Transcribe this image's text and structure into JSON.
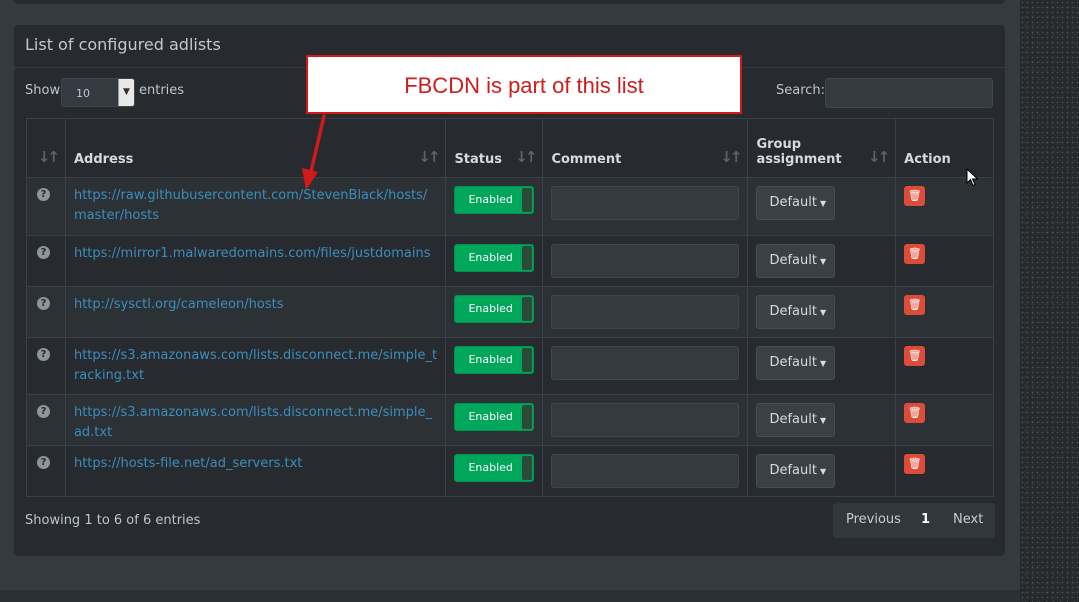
{
  "panel": {
    "title": "List of configured adlists"
  },
  "controls": {
    "show_label": "Show",
    "page_length": "10",
    "entries_label": "entries",
    "search_label": "Search:",
    "search_value": ""
  },
  "table": {
    "headers": [
      "",
      "Address",
      "Status",
      "Comment",
      "Group\nassignment",
      "Action"
    ],
    "header_group_line1": "Group",
    "header_group_line2": "assignment",
    "rows": [
      {
        "address": "https://raw.githubusercontent.com/StevenBlack/hosts/master/hosts",
        "status": "Enabled",
        "comment": "",
        "group": "Default"
      },
      {
        "address": "https://mirror1.malwaredomains.com/files/justdomains",
        "status": "Enabled",
        "comment": "",
        "group": "Default"
      },
      {
        "address": "http://sysctl.org/cameleon/hosts",
        "status": "Enabled",
        "comment": "",
        "group": "Default"
      },
      {
        "address": "https://s3.amazonaws.com/lists.disconnect.me/simple_tracking.txt",
        "status": "Enabled",
        "comment": "",
        "group": "Default"
      },
      {
        "address": "https://s3.amazonaws.com/lists.disconnect.me/simple_ad.txt",
        "status": "Enabled",
        "comment": "",
        "group": "Default"
      },
      {
        "address": "https://hosts-file.net/ad_servers.txt",
        "status": "Enabled",
        "comment": "",
        "group": "Default"
      }
    ]
  },
  "footer": {
    "info": "Showing 1 to 6 of 6 entries",
    "previous": "Previous",
    "current_page": "1",
    "next": "Next"
  },
  "annotation": {
    "callout_text": "FBCDN is part of this list"
  },
  "colors": {
    "enabled": "#00a65a",
    "delete": "#dd4b39",
    "link": "#3c8dbc",
    "callout_border": "#d21a1a"
  },
  "icons": {
    "help": "question-circle-icon",
    "delete": "trash-icon",
    "sort": "sort-icon"
  }
}
